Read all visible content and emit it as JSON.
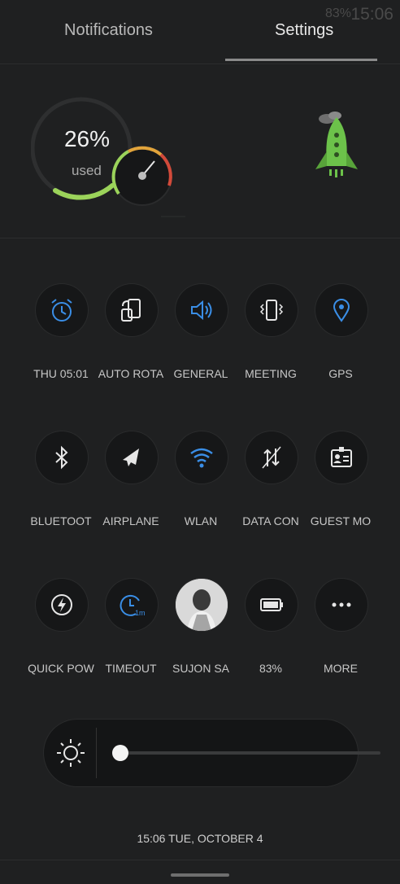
{
  "status": {
    "time": "15:06",
    "battery": "83%"
  },
  "tabs": [
    {
      "label": "Notifications"
    },
    {
      "label": "Settings"
    }
  ],
  "storage": {
    "percent": "26%",
    "used_label": "used",
    "fraction": 0.26
  },
  "tiles": [
    {
      "label": "THU 05:01",
      "icon": "alarm-icon"
    },
    {
      "label": "AUTO ROTA",
      "icon": "auto-rotate-icon"
    },
    {
      "label": "GENERAL",
      "icon": "volume-icon"
    },
    {
      "label": "MEETING",
      "icon": "vibrate-icon"
    },
    {
      "label": "GPS",
      "icon": "location-icon"
    },
    {
      "label": "BLUETOOT",
      "icon": "bluetooth-icon"
    },
    {
      "label": "AIRPLANE",
      "icon": "airplane-icon"
    },
    {
      "label": "WLAN",
      "icon": "wifi-icon"
    },
    {
      "label": "DATA CON",
      "icon": "data-icon"
    },
    {
      "label": "GUEST MO",
      "icon": "guest-icon"
    },
    {
      "label": "QUICK POW",
      "icon": "quick-power-icon"
    },
    {
      "label": "TIMEOUT",
      "icon": "timeout-icon"
    },
    {
      "label": "SUJON SA",
      "icon": "avatar-icon"
    },
    {
      "label": "83%",
      "icon": "battery-icon"
    },
    {
      "label": "MORE",
      "icon": "more-icon"
    }
  ],
  "brightness": {
    "level": 0.0
  },
  "date": "15:06 TUE, OCTOBER 4",
  "colors": {
    "accent_blue": "#3a8ee6",
    "rocket_green": "#6cc24a",
    "background": "#1f2021"
  }
}
